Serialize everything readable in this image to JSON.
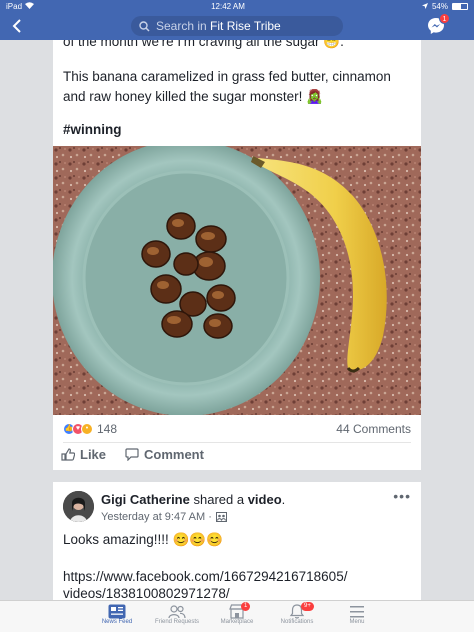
{
  "status_bar": {
    "device": "iPad",
    "time": "12:42 AM",
    "battery": "54%",
    "battery_level": 0.54
  },
  "nav": {
    "search_prefix": "Search in",
    "search_group": "Fit Rise Tribe",
    "messenger_badge": "1"
  },
  "post1": {
    "line_partial": "of the month we're I'm craving all the sugar 😁.",
    "body": "This banana caramelized in grass fed butter, cinnamon and raw honey killed the sugar monster! 🧟‍♀️",
    "hashtag": "#winning",
    "reaction_count": "148",
    "comments": "44 Comments",
    "like_label": "Like",
    "comment_label": "Comment"
  },
  "post2": {
    "author": "Gigi Catherine",
    "shared_text": "shared a",
    "shared_object": "video",
    "timestamp": "Yesterday at 9:47 AM ·",
    "text": "Looks amazing!!!! 😊😊😊",
    "link_line1": "https://www.facebook.com/1667294216718605/",
    "link_line2": "videos/1838100802971278/"
  },
  "tabs": [
    {
      "label": "News Feed",
      "icon": "news-feed-icon",
      "badge": ""
    },
    {
      "label": "Friend Requests",
      "icon": "friends-icon",
      "badge": ""
    },
    {
      "label": "Marketplace",
      "icon": "marketplace-icon",
      "badge": "1"
    },
    {
      "label": "Notifications",
      "icon": "bell-icon",
      "badge": "9+"
    },
    {
      "label": "Menu",
      "icon": "menu-icon",
      "badge": ""
    }
  ],
  "colors": {
    "brand": "#4267b2",
    "badge": "#fa3e3e",
    "text": "#1d2129",
    "muted": "#606770"
  }
}
